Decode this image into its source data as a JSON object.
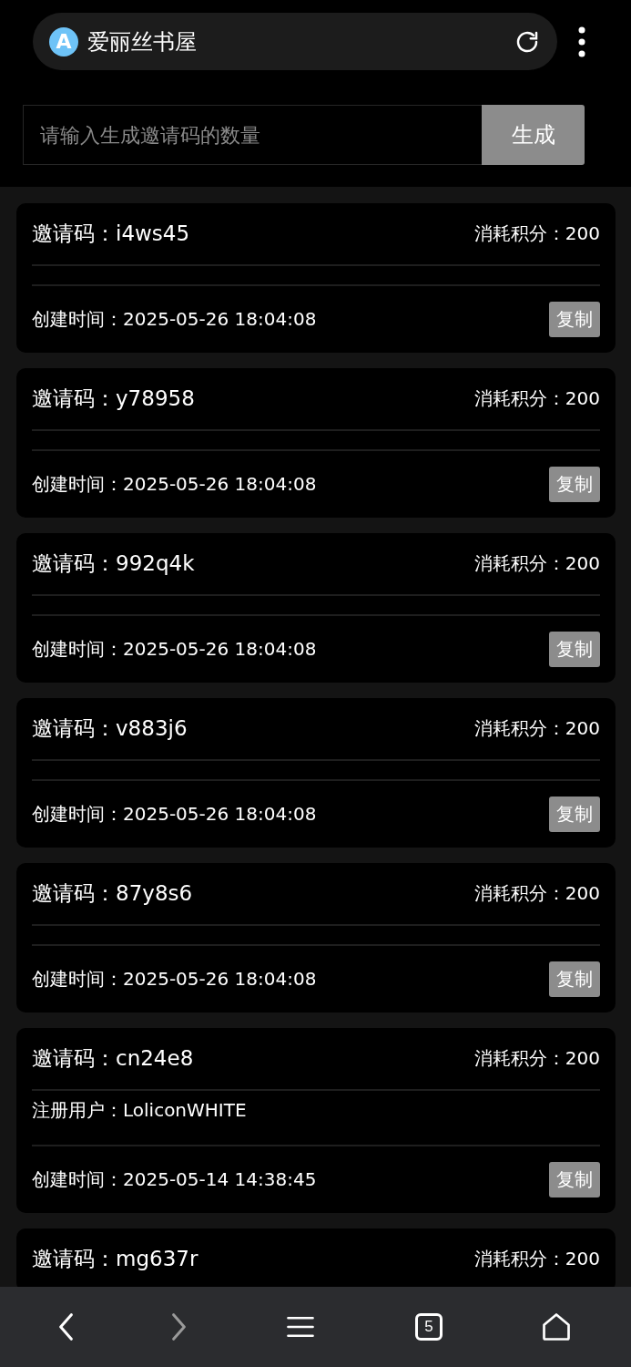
{
  "browser": {
    "logo_letter": "A",
    "title": "爱丽丝书屋"
  },
  "generator": {
    "placeholder": "请输入生成邀请码的数量",
    "button": "生成"
  },
  "cards": [
    {
      "code": "邀请码：i4ws45",
      "points": "消耗积分：200",
      "created": "创建时间：2025-05-26 18:04:08",
      "button": "复制"
    },
    {
      "code": "邀请码：y78958",
      "points": "消耗积分：200",
      "created": "创建时间：2025-05-26 18:04:08",
      "button": "复制"
    },
    {
      "code": "邀请码：992q4k",
      "points": "消耗积分：200",
      "created": "创建时间：2025-05-26 18:04:08",
      "button": "复制"
    },
    {
      "code": "邀请码：v883j6",
      "points": "消耗积分：200",
      "created": "创建时间：2025-05-26 18:04:08",
      "button": "复制"
    },
    {
      "code": "邀请码：87y8s6",
      "points": "消耗积分：200",
      "created": "创建时间：2025-05-26 18:04:08",
      "button": "复制"
    },
    {
      "code": "邀请码：cn24e8",
      "points": "消耗积分：200",
      "user": "注册用户：LoliconWHITE",
      "created": "创建时间：2025-05-14 14:38:45",
      "button": "复制"
    },
    {
      "code": "邀请码：mg637r",
      "points": "消耗积分：200"
    }
  ],
  "nav": [
    {
      "kind": "back",
      "disabled": false
    },
    {
      "kind": "forward",
      "disabled": true
    },
    {
      "kind": "menu",
      "disabled": false
    },
    {
      "kind": "tabs",
      "count": "5",
      "disabled": false
    },
    {
      "kind": "home",
      "disabled": false
    }
  ]
}
